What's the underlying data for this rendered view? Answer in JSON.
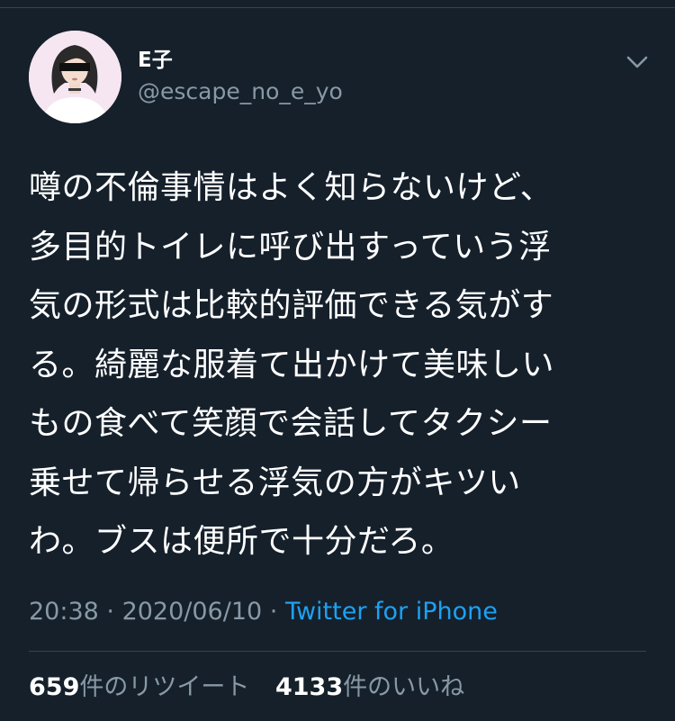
{
  "author": {
    "name": "E子",
    "handle": "@escape_no_e_yo"
  },
  "tweet": {
    "lines": [
      "噂の不倫事情はよく知らないけど、",
      "多目的トイレに呼び出すっていう浮",
      "気の形式は比較的評価できる気がす",
      "る。綺麗な服着て出かけて美味しい",
      "もの食べて笑顔で会話してタクシー",
      "乗せて帰らせる浮気の方がキツい",
      "わ。ブスは便所で十分だろ。"
    ]
  },
  "meta": {
    "time": "20:38",
    "separator": " · ",
    "date": "2020/06/10",
    "source": "Twitter for iPhone"
  },
  "stats": {
    "retweets_count": "659",
    "retweets_label": "件のリツイート",
    "likes_count": "4133",
    "likes_label": "件のいいね"
  },
  "colors": {
    "background": "#15202b",
    "text": "#ffffff",
    "secondary": "#8899a6",
    "link": "#1da1f2",
    "divider": "#38444d"
  },
  "icons": {
    "caret": "chevron-down-icon",
    "avatar": "avatar-illustration"
  }
}
